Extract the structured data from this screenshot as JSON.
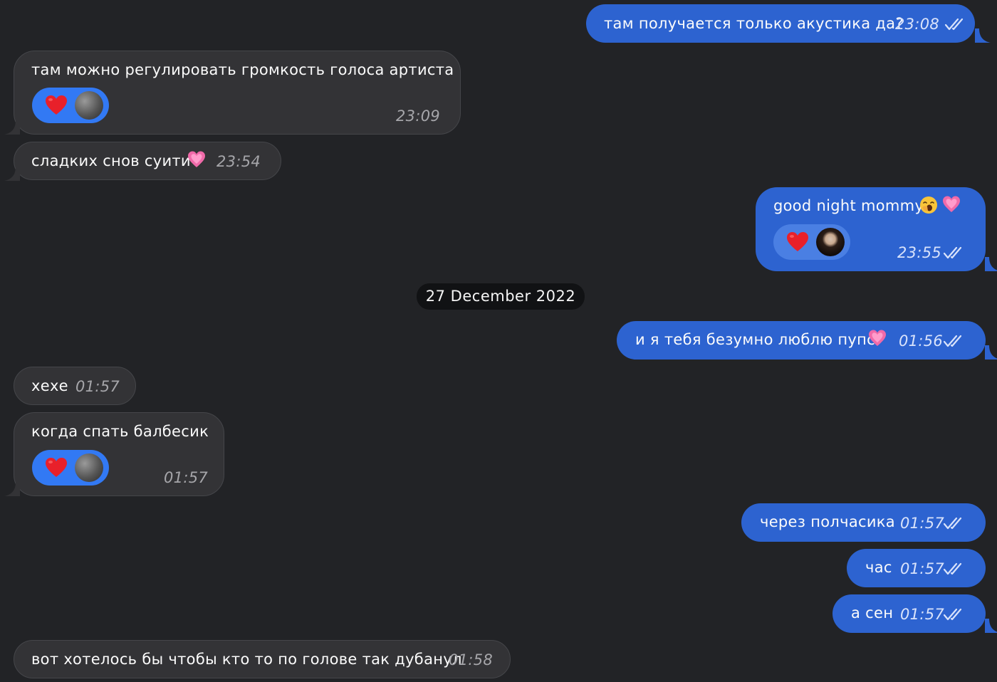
{
  "date_separator": "27 December 2022",
  "messages": [
    {
      "text": "там получается только акустика да?",
      "time": "23:08"
    },
    {
      "text": "там можно регулировать громкость голоса артиста",
      "time": "23:09"
    },
    {
      "text": "сладких снов суити",
      "time": "23:54"
    },
    {
      "text": "good night mommy",
      "time": "23:55"
    },
    {
      "text": "и я тебя безумно люблю пупс",
      "time": "01:56"
    },
    {
      "text": "хехе",
      "time": "01:57"
    },
    {
      "text": "когда спать балбесик",
      "time": "01:57"
    },
    {
      "text": "через полчасика",
      "time": "01:57"
    },
    {
      "text": "час",
      "time": "01:57"
    },
    {
      "text": "а сен",
      "time": "01:57"
    },
    {
      "text": "вот хотелось бы чтобы кто то по голове так дубанул",
      "time": "01:58"
    }
  ],
  "icons": {
    "read": "double-check-icon",
    "reaction": "red-heart-icon",
    "heart_emoji": "pink-heart-icon",
    "yawn_emoji": "yawning-face-icon"
  },
  "colors": {
    "background": "#222326",
    "incoming_bubble": "#333336",
    "outgoing_bubble": "#2d63d0",
    "reaction_pill": "#3279f4"
  }
}
